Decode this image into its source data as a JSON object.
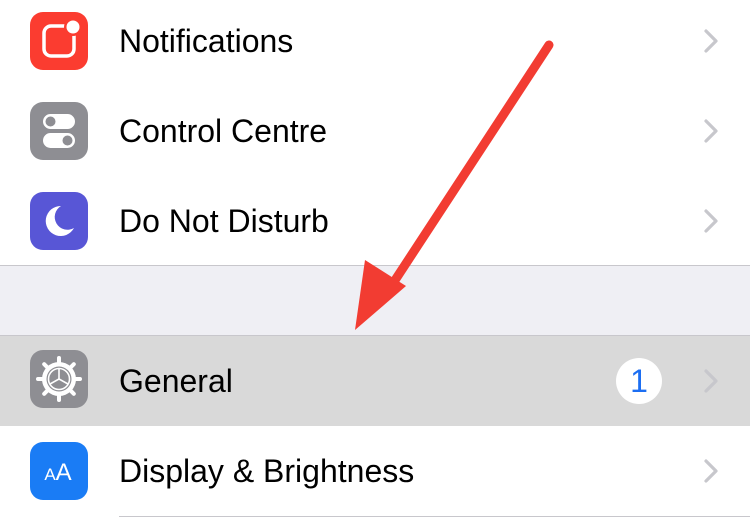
{
  "settings": {
    "items": [
      {
        "label": "Notifications",
        "icon": "notifications-icon",
        "color": "#fb3c30"
      },
      {
        "label": "Control Centre",
        "icon": "control-centre-icon",
        "color": "#8e8e93"
      },
      {
        "label": "Do Not Disturb",
        "icon": "moon-icon",
        "color": "#5856d6"
      },
      {
        "label": "General",
        "icon": "gear-icon",
        "color": "#8e8e93",
        "badge": "1",
        "highlighted": true
      },
      {
        "label": "Display & Brightness",
        "icon": "display-brightness-icon",
        "color": "#1a7cf5",
        "icon_text": "AA"
      }
    ]
  },
  "annotation": {
    "type": "red-arrow",
    "color": "#f23c32",
    "points_to": "General"
  },
  "colors": {
    "background": "#ffffff",
    "group_gap": "#efeff4",
    "separator": "#c8c7cc",
    "highlight": "#d9d9d9",
    "chevron": "#c7c7cc",
    "badge_text": "#1c6ef2"
  }
}
